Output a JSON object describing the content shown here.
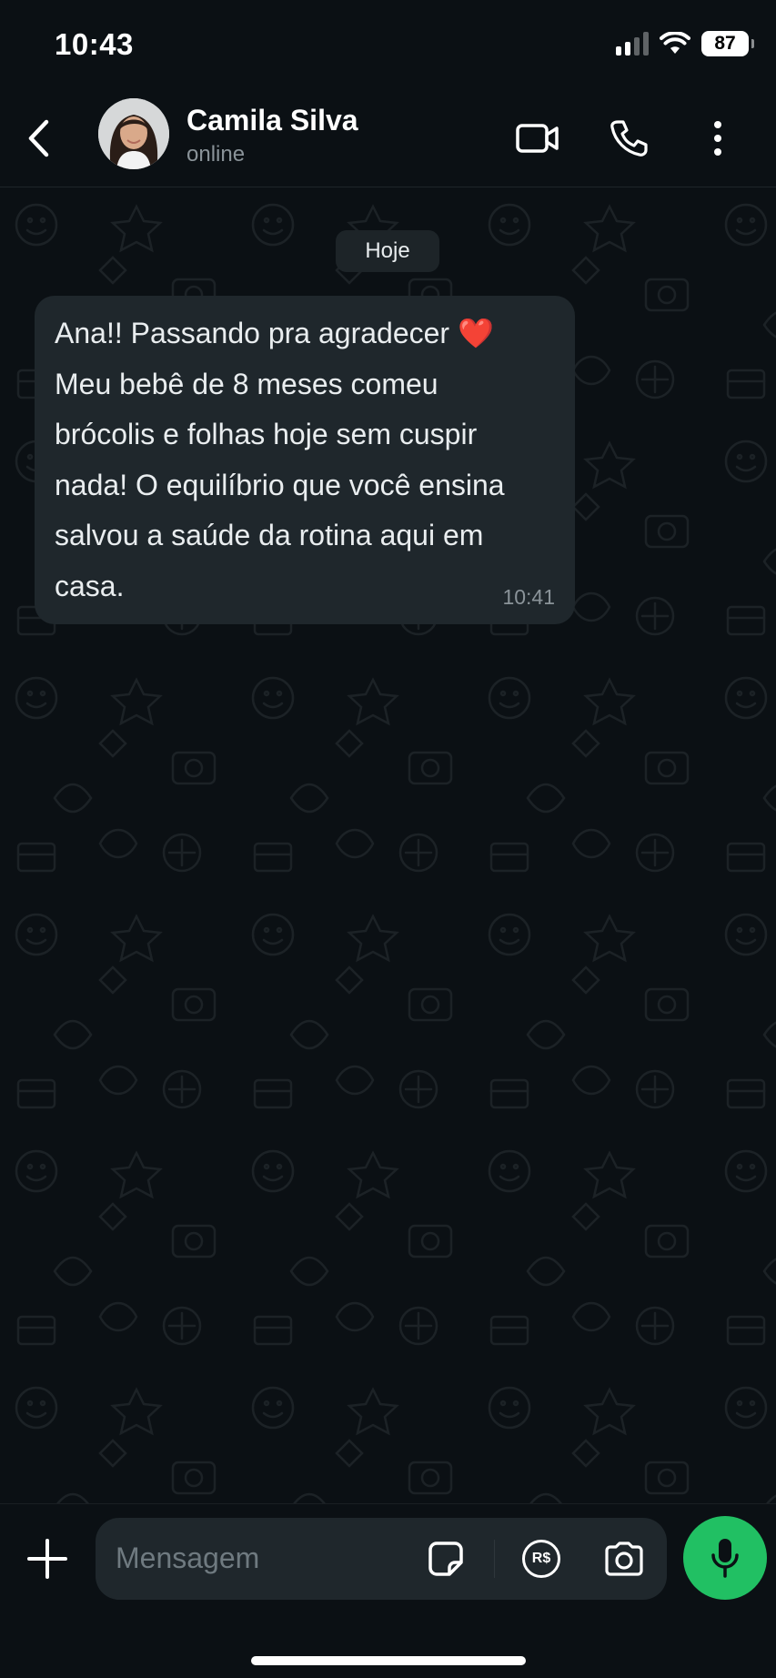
{
  "status_bar": {
    "time": "10:43",
    "battery": "87",
    "icons": [
      "signal-icon",
      "wifi-icon",
      "battery-icon"
    ]
  },
  "header": {
    "contact_name": "Camila Silva",
    "contact_status": "online",
    "icons": [
      "back-chevron-icon",
      "video-call-icon",
      "phone-icon",
      "more-vertical-icon"
    ]
  },
  "chat": {
    "date_label": "Hoje",
    "messages": [
      {
        "text": "Ana!! Passando pra agradecer ❤️\nMeu bebê de 8 meses comeu\nbrócolis e folhas hoje sem cuspir\nnada! O equilíbrio que você ensina\nsalvou a saúde da rotina aqui em\ncasa.",
        "time": "10:41",
        "direction": "incoming"
      }
    ]
  },
  "composer": {
    "placeholder": "Mensagem",
    "icons": [
      "plus-icon",
      "sticker-icon",
      "payment-icon",
      "camera-icon",
      "mic-icon"
    ],
    "payment_label": "R$"
  },
  "colors": {
    "background": "#0b1014",
    "bubble": "#1f272c",
    "accent_green": "#21c063",
    "secondary_text": "#8a9399"
  }
}
